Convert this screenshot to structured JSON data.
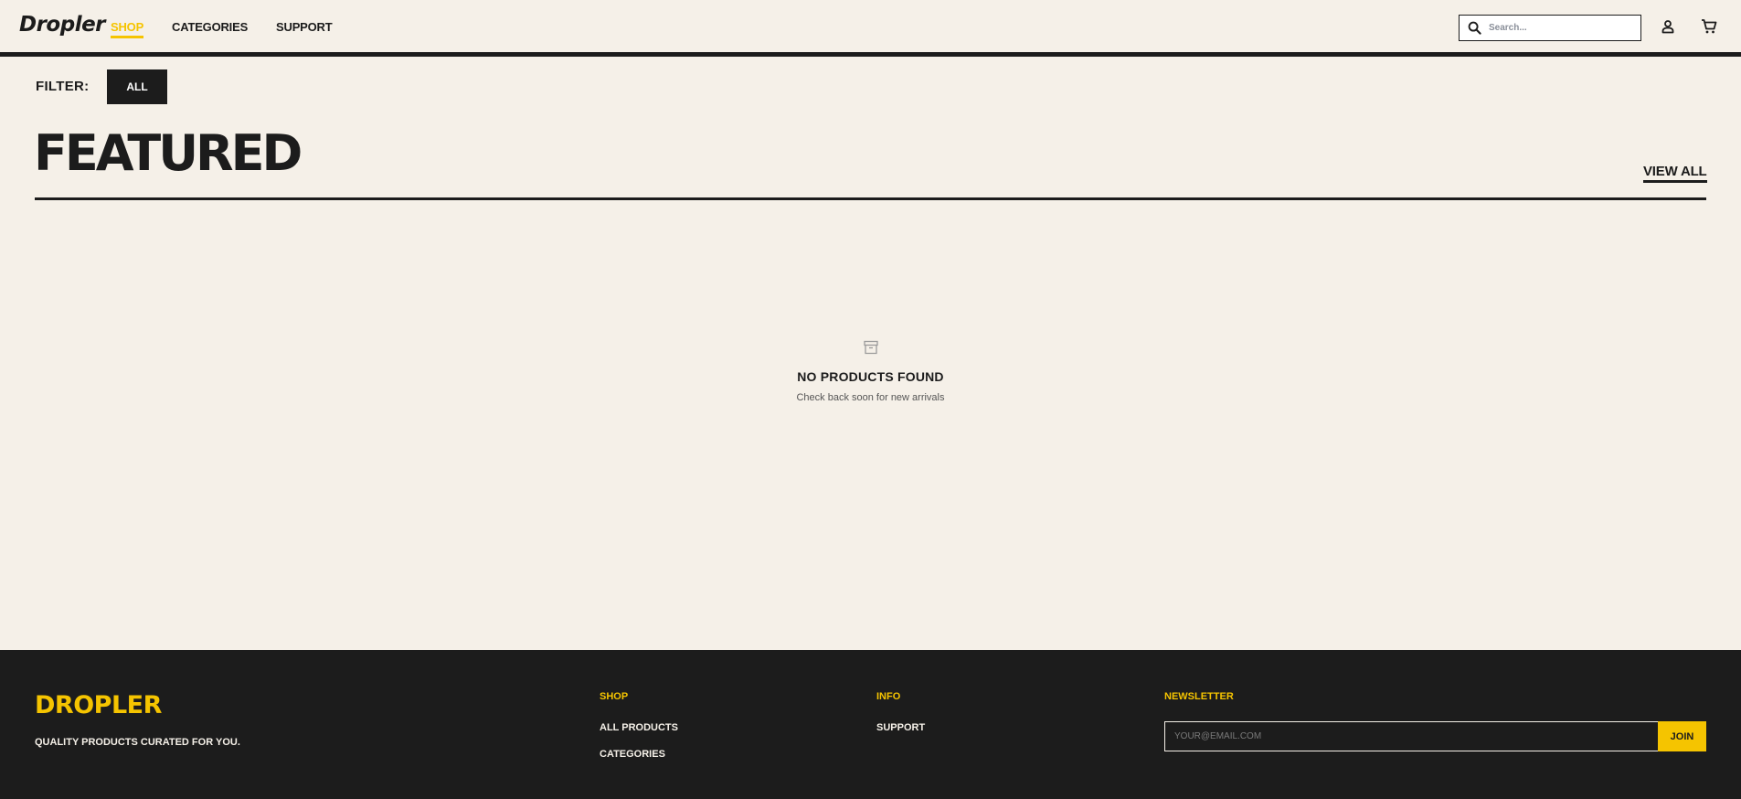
{
  "header": {
    "logo": "Dropler",
    "nav": [
      {
        "label": "SHOP",
        "active": true
      },
      {
        "label": "CATEGORIES",
        "active": false
      },
      {
        "label": "SUPPORT",
        "active": false
      }
    ],
    "search": {
      "placeholder": "Search...",
      "icon": "search-icon"
    },
    "icons": [
      "user-icon",
      "cart-icon"
    ]
  },
  "filter": {
    "label": "FILTER:",
    "options": [
      "ALL"
    ]
  },
  "featured": {
    "title": "FEATURED",
    "view_all": "VIEW ALL"
  },
  "empty_state": {
    "icon": "archive-box-icon",
    "title": "NO PRODUCTS FOUND",
    "subtitle": "Check back soon for new arrivals"
  },
  "footer": {
    "brand": "DROPLER",
    "tagline": "QUALITY PRODUCTS CURATED FOR YOU.",
    "shop": {
      "heading": "SHOP",
      "links": [
        "ALL PRODUCTS",
        "CATEGORIES"
      ]
    },
    "info": {
      "heading": "INFO",
      "links": [
        "SUPPORT"
      ]
    },
    "newsletter": {
      "heading": "NEWSLETTER",
      "placeholder": "YOUR@EMAIL.COM",
      "button": "JOIN"
    }
  },
  "colors": {
    "accent": "#f5c400",
    "dark": "#1c1c1c",
    "background": "#f5f0e8"
  }
}
